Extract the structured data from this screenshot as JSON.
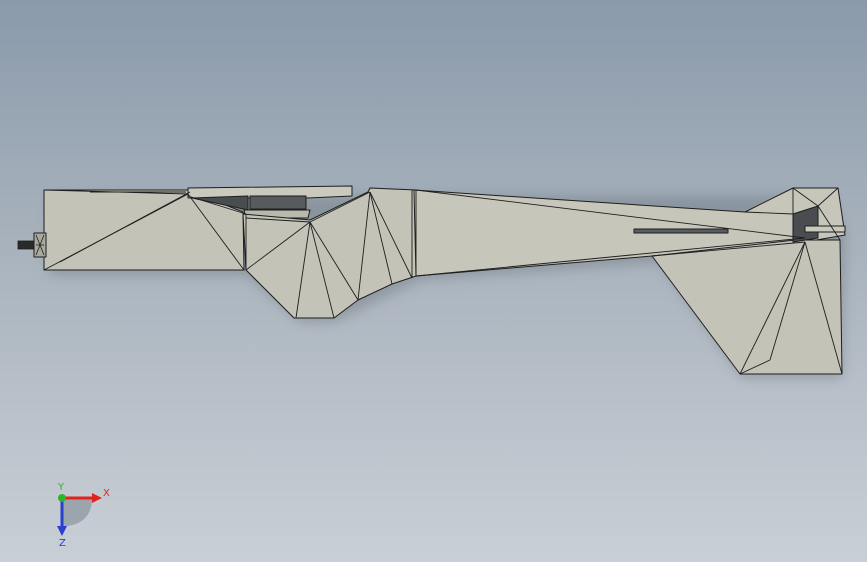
{
  "viewport": {
    "background_top": "#8a9aab",
    "background_bottom": "#c9cfd6"
  },
  "model": {
    "face_color": "#c3c3b7",
    "edge_color": "#1e1e1e",
    "shadow_color": "#6e767e"
  },
  "triad": {
    "x_label": "X",
    "y_label": "Y",
    "z_label": "Z",
    "x_color": "#e0241b",
    "y_color": "#2bb52b",
    "z_color": "#2a3fd0"
  }
}
